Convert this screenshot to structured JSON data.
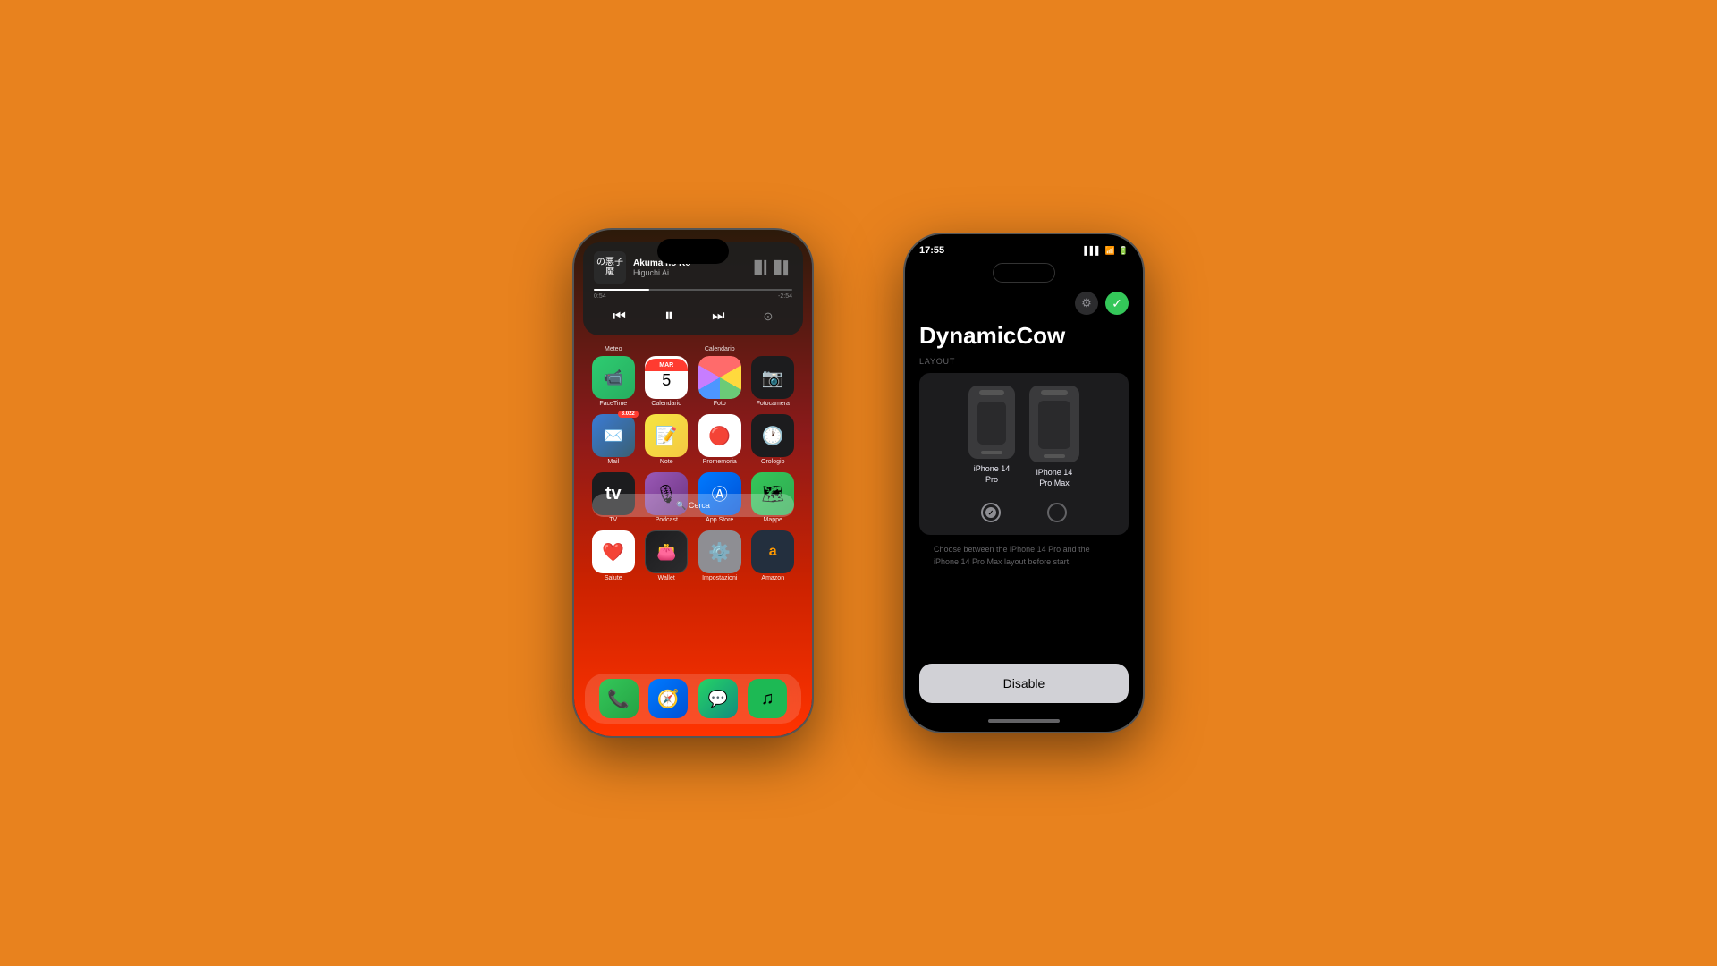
{
  "background_color": "#E8821E",
  "left_phone": {
    "music": {
      "album_art_text": "の\n悪\n子\n魔",
      "title": "Akuma no Ko",
      "artist": "Higuchi Ai",
      "time_current": "0:54",
      "time_remaining": "-2:54",
      "progress_percent": 28
    },
    "folders": {
      "top_left": "Meteo",
      "top_right": "Calendario"
    },
    "apps_row1": [
      {
        "name": "FaceTime",
        "label": "FaceTime",
        "color": "facetime"
      },
      {
        "name": "Calendario",
        "label": "Calendario",
        "color": "calendar",
        "special": "calendar"
      },
      {
        "name": "Foto",
        "label": "Foto",
        "color": "photos",
        "special": "photos"
      },
      {
        "name": "Fotocamera",
        "label": "Fotocamera",
        "color": "camera"
      }
    ],
    "apps_row2": [
      {
        "name": "Mail",
        "label": "Mail",
        "color": "mail",
        "badge": "3.022"
      },
      {
        "name": "Note",
        "label": "Note",
        "color": "notes"
      },
      {
        "name": "Promemoria",
        "label": "Promemoria",
        "color": "reminders"
      },
      {
        "name": "Orologio",
        "label": "Orologio",
        "color": "clock"
      }
    ],
    "apps_row3": [
      {
        "name": "TV",
        "label": "TV",
        "color": "tv"
      },
      {
        "name": "Podcast",
        "label": "Podcast",
        "color": "podcasts"
      },
      {
        "name": "App Store",
        "label": "App Store",
        "color": "appstore"
      },
      {
        "name": "Mappe",
        "label": "Mappe",
        "color": "maps"
      }
    ],
    "apps_row4": [
      {
        "name": "Salute",
        "label": "Salute",
        "color": "health"
      },
      {
        "name": "Wallet",
        "label": "Wallet",
        "color": "wallet"
      },
      {
        "name": "Impostazioni",
        "label": "Impostazioni",
        "color": "settings"
      },
      {
        "name": "Amazon",
        "label": "Amazon",
        "color": "amazon"
      }
    ],
    "search_label": "🔍 Cerca",
    "dock_apps": [
      "Phone",
      "Safari",
      "WhatsApp",
      "Spotify"
    ]
  },
  "right_phone": {
    "status_bar": {
      "time": "17:55",
      "battery": "🔋",
      "wifi": "wifi",
      "signal": "signal"
    },
    "app_title": "DynamicCow",
    "layout_section_label": "LAYOUT",
    "phone_options": [
      {
        "label": "iPhone 14\nPro",
        "selected": true
      },
      {
        "label": "iPhone 14\nPro Max",
        "selected": false
      }
    ],
    "description": "Choose between the iPhone 14 Pro and the iPhone 14 Pro Max layout before start.",
    "disable_button_label": "Disable"
  }
}
